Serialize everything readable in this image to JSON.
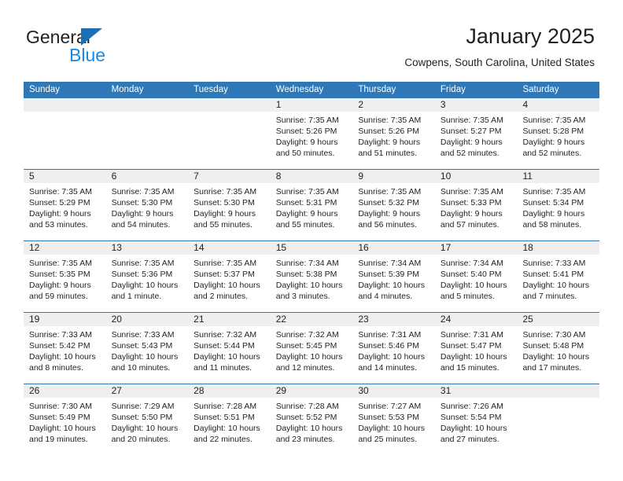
{
  "brand": {
    "line1": "General",
    "line2": "Blue",
    "triangle_color": "#1a6fb5",
    "line2_color": "#1a8ae0"
  },
  "header": {
    "title": "January 2025",
    "subtitle": "Cowpens, South Carolina, United States"
  },
  "theme": {
    "header_blue": "#2e78b8",
    "daynum_band": "#efefef",
    "text": "#231f20"
  },
  "weekdays": [
    "Sunday",
    "Monday",
    "Tuesday",
    "Wednesday",
    "Thursday",
    "Friday",
    "Saturday"
  ],
  "weeks": [
    [
      {
        "day": "",
        "lines": []
      },
      {
        "day": "",
        "lines": []
      },
      {
        "day": "",
        "lines": []
      },
      {
        "day": "1",
        "lines": [
          "Sunrise: 7:35 AM",
          "Sunset: 5:26 PM",
          "Daylight: 9 hours",
          "and 50 minutes."
        ]
      },
      {
        "day": "2",
        "lines": [
          "Sunrise: 7:35 AM",
          "Sunset: 5:26 PM",
          "Daylight: 9 hours",
          "and 51 minutes."
        ]
      },
      {
        "day": "3",
        "lines": [
          "Sunrise: 7:35 AM",
          "Sunset: 5:27 PM",
          "Daylight: 9 hours",
          "and 52 minutes."
        ]
      },
      {
        "day": "4",
        "lines": [
          "Sunrise: 7:35 AM",
          "Sunset: 5:28 PM",
          "Daylight: 9 hours",
          "and 52 minutes."
        ]
      }
    ],
    [
      {
        "day": "5",
        "lines": [
          "Sunrise: 7:35 AM",
          "Sunset: 5:29 PM",
          "Daylight: 9 hours",
          "and 53 minutes."
        ]
      },
      {
        "day": "6",
        "lines": [
          "Sunrise: 7:35 AM",
          "Sunset: 5:30 PM",
          "Daylight: 9 hours",
          "and 54 minutes."
        ]
      },
      {
        "day": "7",
        "lines": [
          "Sunrise: 7:35 AM",
          "Sunset: 5:30 PM",
          "Daylight: 9 hours",
          "and 55 minutes."
        ]
      },
      {
        "day": "8",
        "lines": [
          "Sunrise: 7:35 AM",
          "Sunset: 5:31 PM",
          "Daylight: 9 hours",
          "and 55 minutes."
        ]
      },
      {
        "day": "9",
        "lines": [
          "Sunrise: 7:35 AM",
          "Sunset: 5:32 PM",
          "Daylight: 9 hours",
          "and 56 minutes."
        ]
      },
      {
        "day": "10",
        "lines": [
          "Sunrise: 7:35 AM",
          "Sunset: 5:33 PM",
          "Daylight: 9 hours",
          "and 57 minutes."
        ]
      },
      {
        "day": "11",
        "lines": [
          "Sunrise: 7:35 AM",
          "Sunset: 5:34 PM",
          "Daylight: 9 hours",
          "and 58 minutes."
        ]
      }
    ],
    [
      {
        "day": "12",
        "lines": [
          "Sunrise: 7:35 AM",
          "Sunset: 5:35 PM",
          "Daylight: 9 hours",
          "and 59 minutes."
        ]
      },
      {
        "day": "13",
        "lines": [
          "Sunrise: 7:35 AM",
          "Sunset: 5:36 PM",
          "Daylight: 10 hours",
          "and 1 minute."
        ]
      },
      {
        "day": "14",
        "lines": [
          "Sunrise: 7:35 AM",
          "Sunset: 5:37 PM",
          "Daylight: 10 hours",
          "and 2 minutes."
        ]
      },
      {
        "day": "15",
        "lines": [
          "Sunrise: 7:34 AM",
          "Sunset: 5:38 PM",
          "Daylight: 10 hours",
          "and 3 minutes."
        ]
      },
      {
        "day": "16",
        "lines": [
          "Sunrise: 7:34 AM",
          "Sunset: 5:39 PM",
          "Daylight: 10 hours",
          "and 4 minutes."
        ]
      },
      {
        "day": "17",
        "lines": [
          "Sunrise: 7:34 AM",
          "Sunset: 5:40 PM",
          "Daylight: 10 hours",
          "and 5 minutes."
        ]
      },
      {
        "day": "18",
        "lines": [
          "Sunrise: 7:33 AM",
          "Sunset: 5:41 PM",
          "Daylight: 10 hours",
          "and 7 minutes."
        ]
      }
    ],
    [
      {
        "day": "19",
        "lines": [
          "Sunrise: 7:33 AM",
          "Sunset: 5:42 PM",
          "Daylight: 10 hours",
          "and 8 minutes."
        ]
      },
      {
        "day": "20",
        "lines": [
          "Sunrise: 7:33 AM",
          "Sunset: 5:43 PM",
          "Daylight: 10 hours",
          "and 10 minutes."
        ]
      },
      {
        "day": "21",
        "lines": [
          "Sunrise: 7:32 AM",
          "Sunset: 5:44 PM",
          "Daylight: 10 hours",
          "and 11 minutes."
        ]
      },
      {
        "day": "22",
        "lines": [
          "Sunrise: 7:32 AM",
          "Sunset: 5:45 PM",
          "Daylight: 10 hours",
          "and 12 minutes."
        ]
      },
      {
        "day": "23",
        "lines": [
          "Sunrise: 7:31 AM",
          "Sunset: 5:46 PM",
          "Daylight: 10 hours",
          "and 14 minutes."
        ]
      },
      {
        "day": "24",
        "lines": [
          "Sunrise: 7:31 AM",
          "Sunset: 5:47 PM",
          "Daylight: 10 hours",
          "and 15 minutes."
        ]
      },
      {
        "day": "25",
        "lines": [
          "Sunrise: 7:30 AM",
          "Sunset: 5:48 PM",
          "Daylight: 10 hours",
          "and 17 minutes."
        ]
      }
    ],
    [
      {
        "day": "26",
        "lines": [
          "Sunrise: 7:30 AM",
          "Sunset: 5:49 PM",
          "Daylight: 10 hours",
          "and 19 minutes."
        ]
      },
      {
        "day": "27",
        "lines": [
          "Sunrise: 7:29 AM",
          "Sunset: 5:50 PM",
          "Daylight: 10 hours",
          "and 20 minutes."
        ]
      },
      {
        "day": "28",
        "lines": [
          "Sunrise: 7:28 AM",
          "Sunset: 5:51 PM",
          "Daylight: 10 hours",
          "and 22 minutes."
        ]
      },
      {
        "day": "29",
        "lines": [
          "Sunrise: 7:28 AM",
          "Sunset: 5:52 PM",
          "Daylight: 10 hours",
          "and 23 minutes."
        ]
      },
      {
        "day": "30",
        "lines": [
          "Sunrise: 7:27 AM",
          "Sunset: 5:53 PM",
          "Daylight: 10 hours",
          "and 25 minutes."
        ]
      },
      {
        "day": "31",
        "lines": [
          "Sunrise: 7:26 AM",
          "Sunset: 5:54 PM",
          "Daylight: 10 hours",
          "and 27 minutes."
        ]
      },
      {
        "day": "",
        "lines": []
      }
    ]
  ]
}
